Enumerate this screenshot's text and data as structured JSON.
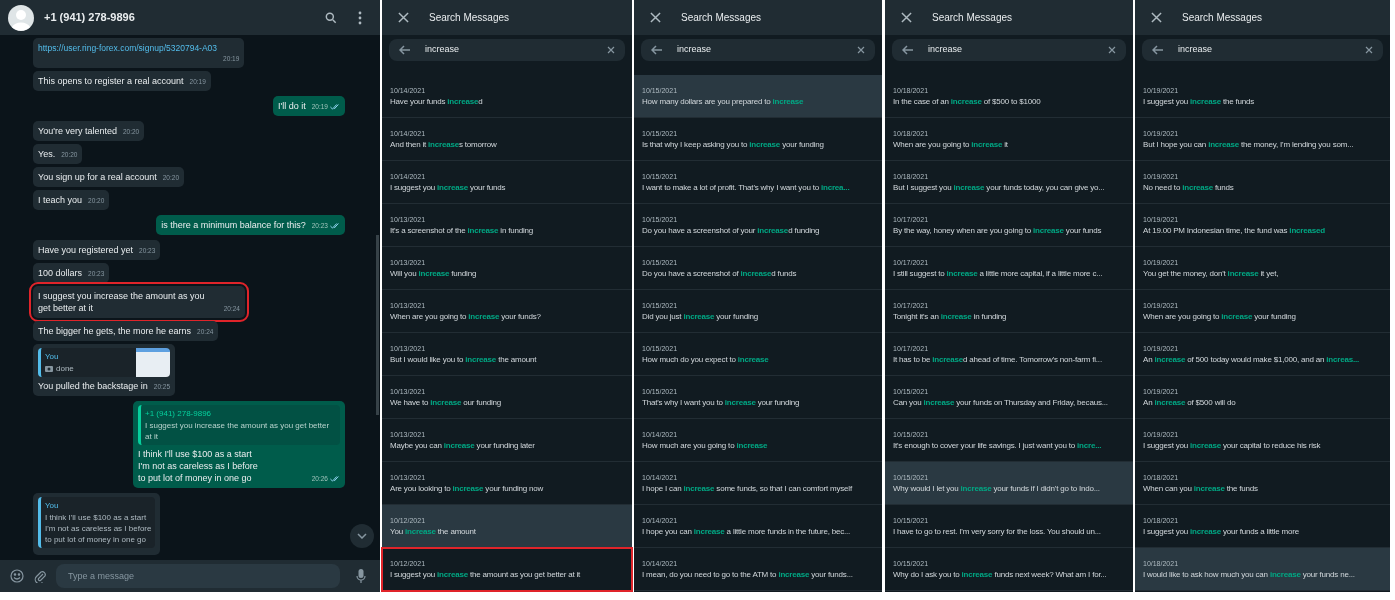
{
  "chat": {
    "contact": "+1 (941) 278-9896",
    "messages": [
      {
        "kind": "link",
        "outgoing": false,
        "text": "https://user.ring-forex.com/signup/5320794-A03",
        "time": "20:19",
        "highlighted": false
      },
      {
        "kind": "text",
        "outgoing": false,
        "text": "This opens to register a real account",
        "time": "20:19",
        "highlighted": false
      },
      {
        "kind": "text",
        "outgoing": true,
        "text": "I'll do it",
        "time": "20:19",
        "highlighted": false
      },
      {
        "kind": "text",
        "outgoing": false,
        "text": "You're very talented",
        "time": "20:20",
        "highlighted": false
      },
      {
        "kind": "text",
        "outgoing": false,
        "text": "Yes.",
        "time": "20:20",
        "highlighted": false
      },
      {
        "kind": "text",
        "outgoing": false,
        "text": "You sign up for a real account",
        "time": "20:20",
        "highlighted": false
      },
      {
        "kind": "text",
        "outgoing": false,
        "text": "I teach you",
        "time": "20:20",
        "highlighted": false
      },
      {
        "kind": "text",
        "outgoing": true,
        "text": "is there a minimum balance for this?",
        "time": "20:23",
        "highlighted": false
      },
      {
        "kind": "text",
        "outgoing": false,
        "text": "Have you registered yet",
        "time": "20:23",
        "highlighted": false
      },
      {
        "kind": "text",
        "outgoing": false,
        "text": "100 dollars",
        "time": "20:23",
        "highlighted": false
      },
      {
        "kind": "text",
        "outgoing": false,
        "text": "I suggest you increase the amount as you get better at it",
        "time": "20:24",
        "highlighted": true
      },
      {
        "kind": "text",
        "outgoing": false,
        "text": "The bigger he gets, the more he earns",
        "time": "20:24",
        "highlighted": false
      },
      {
        "kind": "quoted",
        "outgoing": false,
        "quote": {
          "author": "You",
          "text": "done",
          "photo": true
        },
        "text": "You pulled the backstage in",
        "time": "20:25",
        "highlighted": false
      },
      {
        "kind": "quoted",
        "outgoing": true,
        "quote": {
          "author": "+1 (941) 278-9896",
          "text": "I suggest you increase the amount as you get better at it"
        },
        "text": "I think I'll use $100 as a start\nI'm not as careless as I before\nto put lot of money in one go",
        "time": "20:26",
        "highlighted": false
      },
      {
        "kind": "quoted",
        "outgoing": false,
        "quote": {
          "author": "You",
          "text": "I think I'll use $100 as a start\nI'm not as careless as I before\nto put lot of money in one go"
        },
        "highlighted": false
      }
    ],
    "composer": {
      "placeholder": "Type a message"
    }
  },
  "search_panels": [
    {
      "title": "Search Messages",
      "query": "increase",
      "results": [
        {
          "date": "10/14/2021",
          "text": "Have your funds **increase**d",
          "selected": false,
          "highlighted": false
        },
        {
          "date": "10/14/2021",
          "text": "And then it **increase**s tomorrow",
          "selected": false,
          "highlighted": false
        },
        {
          "date": "10/14/2021",
          "text": "I suggest you **increase** your funds",
          "selected": false,
          "highlighted": false
        },
        {
          "date": "10/13/2021",
          "text": "It's a screenshot of the **increase** in funding",
          "selected": false,
          "highlighted": false
        },
        {
          "date": "10/13/2021",
          "text": "Will you **increase** funding",
          "selected": false,
          "highlighted": false
        },
        {
          "date": "10/13/2021",
          "text": "When are you going to **increase** your funds?",
          "selected": false,
          "highlighted": false
        },
        {
          "date": "10/13/2021",
          "text": "But I would like you to **increase** the amount",
          "selected": false,
          "highlighted": false
        },
        {
          "date": "10/13/2021",
          "text": "We have to **increase** our funding",
          "selected": false,
          "highlighted": false
        },
        {
          "date": "10/13/2021",
          "text": "Maybe you can **increase** your funding later",
          "selected": false,
          "highlighted": false
        },
        {
          "date": "10/13/2021",
          "text": "Are you looking to **increase** your funding now",
          "selected": false,
          "highlighted": false
        },
        {
          "date": "10/12/2021",
          "text": "You **increase** the amount",
          "selected": true,
          "highlighted": false
        },
        {
          "date": "10/12/2021",
          "text": "I suggest you **increase** the amount as you get better at it",
          "selected": false,
          "highlighted": true
        }
      ]
    },
    {
      "title": "Search Messages",
      "query": "increase",
      "results": [
        {
          "date": "10/15/2021",
          "text": "How many dollars are you prepared to **increase**",
          "selected": true,
          "highlighted": false
        },
        {
          "date": "10/15/2021",
          "text": "Is that why I keep asking you to **increase** your funding",
          "selected": false,
          "highlighted": false
        },
        {
          "date": "10/15/2021",
          "text": "I want to make a lot of profit. That's why I want you to **increa...**",
          "selected": false,
          "highlighted": false
        },
        {
          "date": "10/15/2021",
          "text": "Do you have a screenshot of your **increase**d funding",
          "selected": false,
          "highlighted": false
        },
        {
          "date": "10/15/2021",
          "text": "Do you have a screenshot of **increase**d funds",
          "selected": false,
          "highlighted": false
        },
        {
          "date": "10/15/2021",
          "text": "Did you just **increase** your funding",
          "selected": false,
          "highlighted": false
        },
        {
          "date": "10/15/2021",
          "text": "How much do you expect to **increase**",
          "selected": false,
          "highlighted": false
        },
        {
          "date": "10/15/2021",
          "text": "That's why I want you to **increase** your funding",
          "selected": false,
          "highlighted": false
        },
        {
          "date": "10/14/2021",
          "text": "How much are you going to **increase**",
          "selected": false,
          "highlighted": false
        },
        {
          "date": "10/14/2021",
          "text": "I hope I can **increase** some funds, so that I can comfort myself",
          "selected": false,
          "highlighted": false
        },
        {
          "date": "10/14/2021",
          "text": "I hope you can **increase** a little more funds in the future, bec...",
          "selected": false,
          "highlighted": false
        },
        {
          "date": "10/14/2021",
          "text": "I mean, do you need to go to the ATM to **increase** your funds...",
          "selected": false,
          "highlighted": false
        }
      ]
    },
    {
      "title": "Search Messages",
      "query": "increase",
      "results": [
        {
          "date": "10/18/2021",
          "text": "In the case of an **increase** of $500 to $1000",
          "selected": false,
          "highlighted": false
        },
        {
          "date": "10/18/2021",
          "text": "When are you going to **increase** it",
          "selected": false,
          "highlighted": false
        },
        {
          "date": "10/18/2021",
          "text": "But I suggest you **increase** your funds today, you can give yo...",
          "selected": false,
          "highlighted": false
        },
        {
          "date": "10/17/2021",
          "text": "By the way, honey when are you going to **increase** your funds",
          "selected": false,
          "highlighted": false
        },
        {
          "date": "10/17/2021",
          "text": "I still suggest to **increase** a little more capital, if a little more c...",
          "selected": false,
          "highlighted": false
        },
        {
          "date": "10/17/2021",
          "text": "Tonight it's an **increase** in funding",
          "selected": false,
          "highlighted": false
        },
        {
          "date": "10/17/2021",
          "text": "It has to be **increase**d ahead of time. Tomorrow's non-farm fi...",
          "selected": false,
          "highlighted": false
        },
        {
          "date": "10/15/2021",
          "text": "Can you **increase** your funds on Thursday and Friday, becaus...",
          "selected": false,
          "highlighted": false
        },
        {
          "date": "10/15/2021",
          "text": "It's enough to cover your life savings. I just want you to **incre...**",
          "selected": false,
          "highlighted": false
        },
        {
          "date": "10/15/2021",
          "text": "Why would I let you **increase** your funds if I didn't go to Indo...",
          "selected": true,
          "highlighted": false
        },
        {
          "date": "10/15/2021",
          "text": "I have to go to rest. I'm very sorry for the loss. You should un...",
          "selected": false,
          "highlighted": false
        },
        {
          "date": "10/15/2021",
          "text": "Why do I ask you to **increase** funds next week? What am I for...",
          "selected": false,
          "highlighted": false
        }
      ]
    },
    {
      "title": "Search Messages",
      "query": "increase",
      "results": [
        {
          "date": "10/19/2021",
          "text": "I suggest you **increase** the funds",
          "selected": false,
          "highlighted": false
        },
        {
          "date": "10/19/2021",
          "text": "But I hope you can **increase** the money, I'm lending you som...",
          "selected": false,
          "highlighted": false
        },
        {
          "date": "10/19/2021",
          "text": "No need to **increase** funds",
          "selected": false,
          "highlighted": false
        },
        {
          "date": "10/19/2021",
          "text": "At 19.00 PM Indonesian time, the fund was **increased**",
          "selected": false,
          "highlighted": false
        },
        {
          "date": "10/19/2021",
          "text": "You get the money, don't **increase** it yet,",
          "selected": false,
          "highlighted": false
        },
        {
          "date": "10/19/2021",
          "text": "When are you going to **increase** your funding",
          "selected": false,
          "highlighted": false
        },
        {
          "date": "10/19/2021",
          "text": "An **increase** of 500 today would make $1,000, and an **increas...**",
          "selected": false,
          "highlighted": false
        },
        {
          "date": "10/19/2021",
          "text": "An **increase** of $500 will do",
          "selected": false,
          "highlighted": false
        },
        {
          "date": "10/19/2021",
          "text": "I suggest you **increase** your capital to reduce his risk",
          "selected": false,
          "highlighted": false
        },
        {
          "date": "10/18/2021",
          "text": "When can you **increase** the funds",
          "selected": false,
          "highlighted": false
        },
        {
          "date": "10/18/2021",
          "text": "I suggest you **increase** your funds a little more",
          "selected": false,
          "highlighted": false
        },
        {
          "date": "10/18/2021",
          "text": "I would like to ask how much you can **increase** your funds ne...",
          "selected": true,
          "highlighted": false
        }
      ]
    }
  ]
}
